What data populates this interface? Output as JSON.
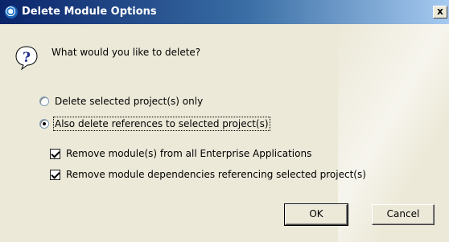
{
  "dialog": {
    "title": "Delete Module Options",
    "close_glyph": "x",
    "prompt": "What would you like to delete?",
    "options": [
      {
        "label": "Delete selected project(s) only",
        "selected": false
      },
      {
        "label": "Also delete references to selected project(s)",
        "selected": true
      }
    ],
    "checkboxes": [
      {
        "label": "Remove module(s) from all Enterprise Applications",
        "checked": true
      },
      {
        "label": "Remove module dependencies referencing selected project(s)",
        "checked": true
      }
    ],
    "buttons": {
      "ok": "OK",
      "cancel": "Cancel"
    },
    "icons": {
      "app": "eclipse-app-icon",
      "prompt": "question-icon",
      "close": "close-icon"
    }
  }
}
